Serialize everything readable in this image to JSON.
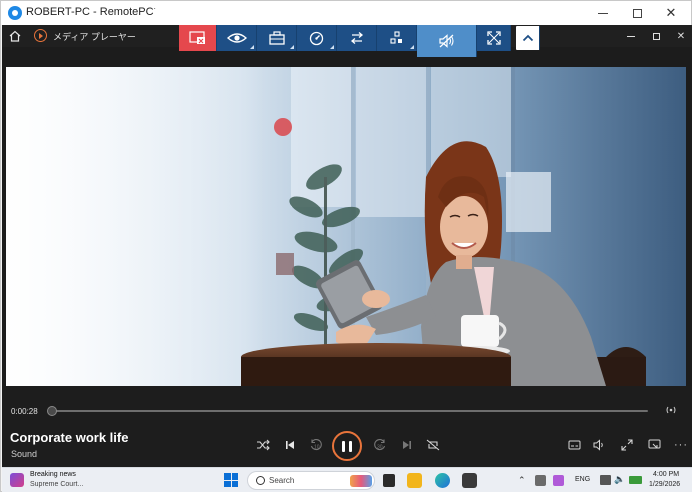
{
  "window": {
    "title": "ROBERT-PC - RemotePC",
    "title_suffix": "˙"
  },
  "remote_window": {
    "title": "メディア プレーヤー"
  },
  "toolbar": {
    "buttons": [
      {
        "name": "disconnect",
        "icon": "screen-close-icon"
      },
      {
        "name": "view",
        "icon": "eye-icon"
      },
      {
        "name": "actions",
        "icon": "toolbox-icon"
      },
      {
        "name": "performance",
        "icon": "gauge-icon"
      },
      {
        "name": "transfer",
        "icon": "transfer-arrows-icon"
      },
      {
        "name": "apps",
        "icon": "grid-icon"
      },
      {
        "name": "sound",
        "icon": "speaker-muted-icon"
      },
      {
        "name": "fullscreen",
        "icon": "expand-icon"
      },
      {
        "name": "collapse",
        "icon": "chevron-up-icon"
      }
    ]
  },
  "player": {
    "current_time": "0:00:28",
    "progress": 0.0,
    "track_title": "Corporate work life",
    "track_subtitle": "Sound",
    "play_state": "playing"
  },
  "taskbar": {
    "news_title": "Breaking news",
    "news_subtitle": "Supreme Court...",
    "search_placeholder": "Search",
    "language": "ENG",
    "time": "4:00 PM",
    "date": "1/29/2026"
  },
  "colors": {
    "toolbar_blue": "#1e4f86",
    "toolbar_red": "#e5484d",
    "toolbar_active": "#4f8ec9",
    "accent_orange": "#e8743b"
  }
}
